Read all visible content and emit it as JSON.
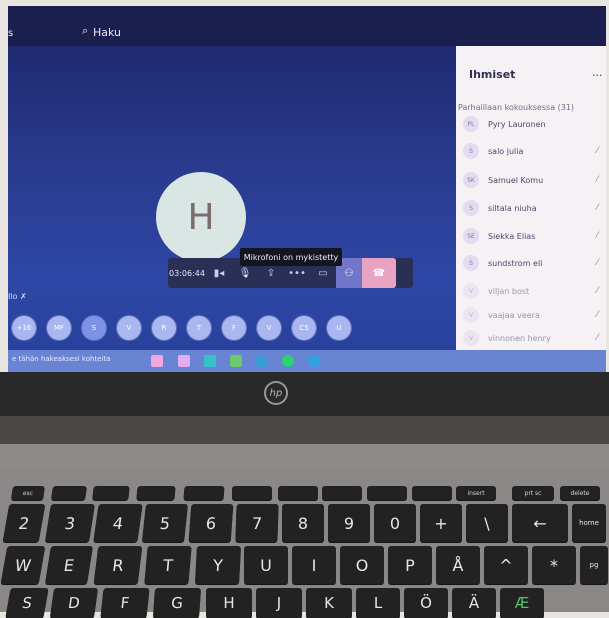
{
  "meeting": {
    "search_label": "Haku",
    "avatar_initial": "H",
    "tooltip": "Mikrofoni on mykistetty",
    "timer": "03:06:44",
    "taskbar_text": "e tähän hakeaksesi kohteita",
    "bubbles": [
      "+16",
      "MF",
      "S",
      "V",
      "R",
      "T",
      "F",
      "V",
      "CS",
      "U"
    ]
  },
  "people_panel": {
    "title": "Ihmiset",
    "more": "...",
    "section_label": "Parhaillaan kokouksessa (31)",
    "people": [
      {
        "initials": "PL",
        "name": "Pyry Lauronen"
      },
      {
        "initials": "S",
        "name": "salo julia"
      },
      {
        "initials": "SK",
        "name": "Samuel Komu"
      },
      {
        "initials": "S",
        "name": "siltala niuha"
      },
      {
        "initials": "SE",
        "name": "Siekka Elias"
      },
      {
        "initials": "S",
        "name": "sundstrom eli"
      },
      {
        "initials": "V",
        "name": "viljan bost"
      },
      {
        "initials": "V",
        "name": "vaajaa veera"
      },
      {
        "initials": "V",
        "name": "vinnonen henry"
      }
    ]
  },
  "laptop": {
    "brand": "hp",
    "fkeys": [
      "esc",
      "",
      "",
      "",
      "",
      "",
      "",
      "",
      "",
      "",
      "",
      "",
      "insert",
      "prt sc",
      "delete"
    ],
    "row_numbers": [
      "2",
      "3",
      "4",
      "5",
      "6",
      "7",
      "8",
      "9",
      "0",
      "+",
      "\\",
      "←",
      "home"
    ],
    "row_qwerty": [
      "W",
      "E",
      "R",
      "T",
      "Y",
      "U",
      "I",
      "O",
      "P",
      "Å",
      "^",
      "*",
      "pg"
    ],
    "row_asdf": [
      "S",
      "D",
      "F",
      "G",
      "H",
      "J",
      "K",
      "L",
      "Ö",
      "Ä",
      "Æ"
    ]
  },
  "colors": {
    "screen_bg": "#2a3b8f",
    "panel_bg": "#f6f1f5",
    "hangup": "#e8a2c2",
    "share": "#7176c8"
  }
}
